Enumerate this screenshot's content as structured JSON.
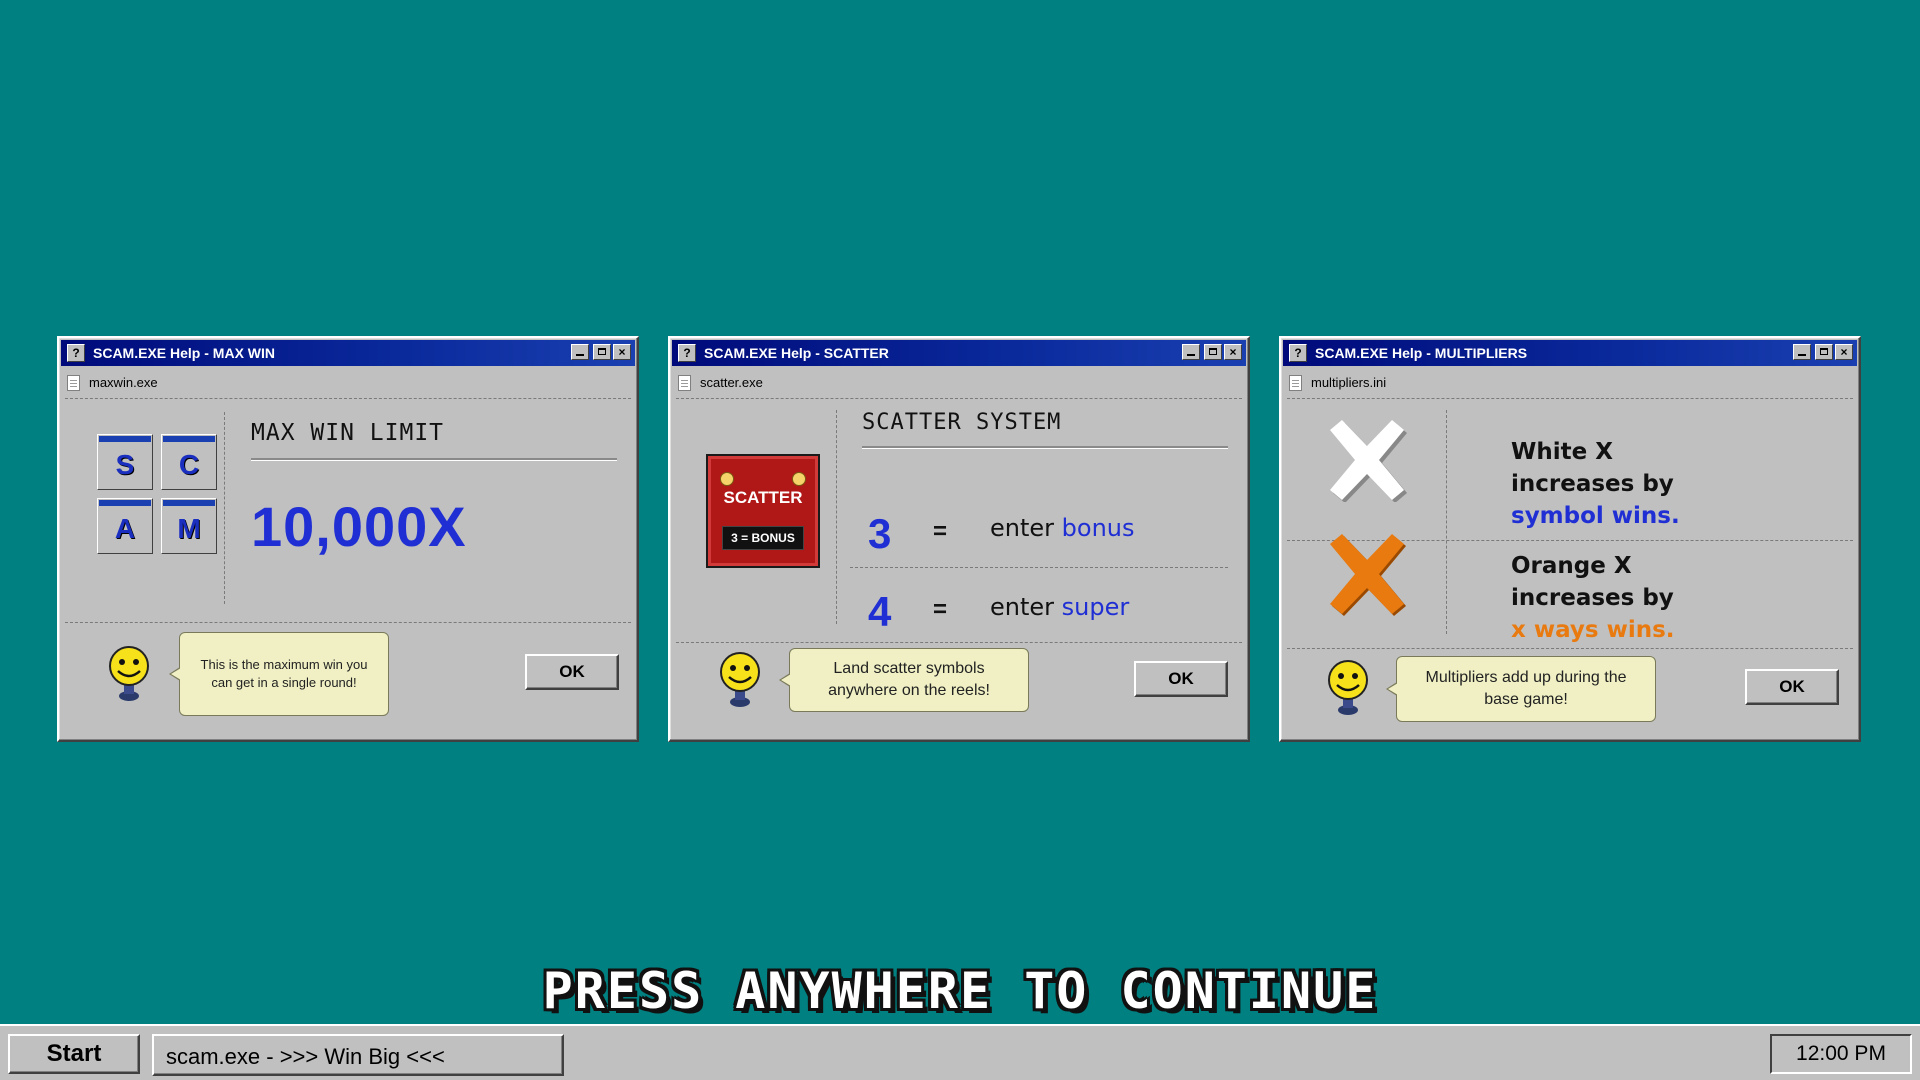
{
  "windows": [
    {
      "title": "SCAM.EXE Help - MAX WIN",
      "help_glyph": "?",
      "file": "maxwin.exe",
      "tiles": [
        "S",
        "C",
        "A",
        "M"
      ],
      "heading": "MAX WIN LIMIT",
      "value": "10,000X",
      "bubble": "This is the maximum win you can get in a single round!",
      "ok": "OK"
    },
    {
      "title": "SCAM.EXE Help - SCATTER",
      "help_glyph": "?",
      "file": "scatter.exe",
      "card_label": "SCATTER",
      "card_badge": "3 = BONUS",
      "heading": "SCATTER SYSTEM",
      "rows": [
        {
          "count": "3",
          "eq": "=",
          "prefix": "enter ",
          "mode": "bonus"
        },
        {
          "count": "4",
          "eq": "=",
          "prefix": "enter ",
          "mode": "super"
        }
      ],
      "bubble": "Land scatter symbols anywhere on the reels!",
      "ok": "OK"
    },
    {
      "title": "SCAM.EXE Help - MULTIPLIERS",
      "help_glyph": "?",
      "file": "multipliers.ini",
      "items": [
        {
          "line1": "White X",
          "line2": "increases by",
          "line3": "symbol wins.",
          "mark_color": "#ffffff"
        },
        {
          "line1": "Orange X",
          "line2": "increases by",
          "line3": "x ways wins.",
          "mark_color": "#e87a10"
        }
      ],
      "bubble": "Multipliers add up during the base game!",
      "ok": "OK"
    }
  ],
  "prompt": "PRESS ANYWHERE TO CONTINUE",
  "taskbar": {
    "start": "Start",
    "task": "scam.exe - >>> Win Big <<<",
    "clock": "12:00 PM"
  },
  "colors": {
    "desktop": "#008080",
    "title_bar": "#0a2a9c",
    "accent_blue": "#1f2fd4",
    "accent_orange": "#e87a10",
    "bubble": "#f0f0c4"
  },
  "icons": [
    "help-icon",
    "minimize-icon",
    "maximize-icon",
    "close-icon",
    "file-icon",
    "assistant-smiley-icon",
    "white-x-icon",
    "orange-x-icon",
    "scatter-symbol-icon"
  ]
}
